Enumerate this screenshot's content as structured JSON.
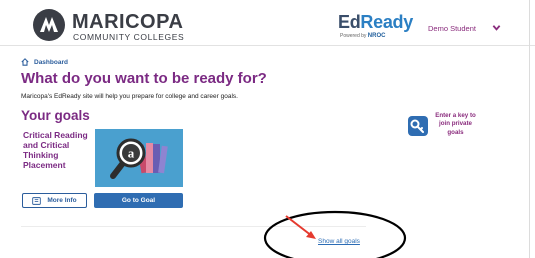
{
  "header": {
    "brand_name": "MARICOPA",
    "brand_sub": "COMMUNITY COLLEGES",
    "app_name_prefix": "Ed",
    "app_name_suffix": "Ready",
    "powered_prefix": "Powered by",
    "powered_brand": "NROC",
    "user_name": "Demo Student",
    "user_menu_icon": "chevron-down-icon"
  },
  "breadcrumb": {
    "icon": "home-icon",
    "label": "Dashboard"
  },
  "main": {
    "headline": "What do you want to be ready for?",
    "subtitle": "Maricopa's EdReady site will help you prepare for college and career goals.",
    "section_title": "Your goals",
    "goals": [
      {
        "name": "Critical Reading and Critical Thinking Placement",
        "more_info_label": "More Info",
        "go_label": "Go to Goal"
      }
    ],
    "show_all_label": "Show all goals"
  },
  "key_box": {
    "icon": "key-icon",
    "label": "Enter a key to join private goals"
  },
  "colors": {
    "accent_purple": "#7b2a83",
    "primary_blue": "#2f6db2",
    "goal_tile": "#4aa0cf",
    "annotation_red": "#e53a2f"
  }
}
